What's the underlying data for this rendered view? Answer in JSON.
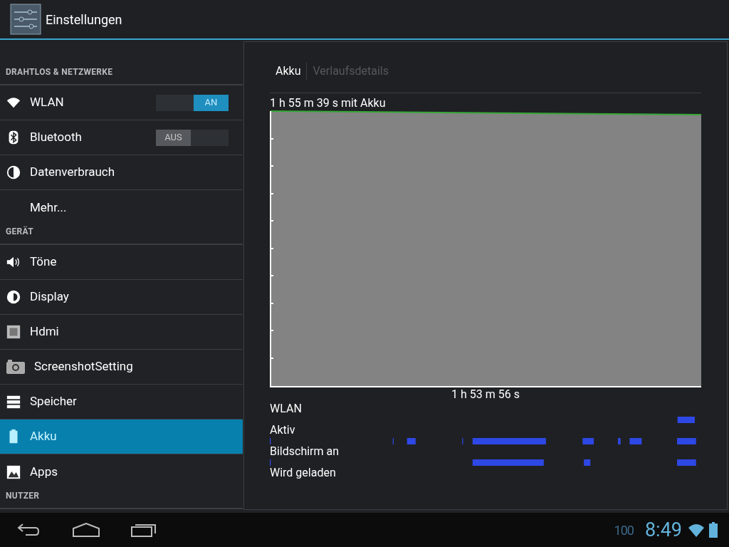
{
  "action_bar": {
    "title": "Einstellungen"
  },
  "sidebar": {
    "sections": [
      {
        "header": "DRAHTLOS & NETZWERKE",
        "items": [
          {
            "label": "WLAN",
            "kind": "toggle",
            "toggle": {
              "label": "AN",
              "on": true
            },
            "selected": false
          },
          {
            "label": "Bluetooth",
            "kind": "toggle",
            "toggle": {
              "label": "AUS",
              "on": false
            },
            "selected": false
          },
          {
            "label": "Datenverbrauch",
            "kind": "plain",
            "selected": false
          },
          {
            "label": "Mehr...",
            "kind": "plain",
            "selected": false
          }
        ]
      },
      {
        "header": "GERÄT",
        "items": [
          {
            "label": "Töne",
            "kind": "plain",
            "selected": false
          },
          {
            "label": "Display",
            "kind": "plain",
            "selected": false
          },
          {
            "label": "Hdmi",
            "kind": "plain",
            "selected": false
          },
          {
            "label": "ScreenshotSetting",
            "kind": "plain",
            "selected": false
          },
          {
            "label": "Speicher",
            "kind": "plain",
            "selected": false
          },
          {
            "label": "Akku",
            "kind": "plain",
            "selected": true
          },
          {
            "label": "Apps",
            "kind": "plain",
            "selected": false
          }
        ]
      },
      {
        "header": "NUTZER"
      }
    ]
  },
  "detail": {
    "breadcrumbs": [
      {
        "label": "Akku",
        "selected": true
      },
      {
        "label": "Verlaufsdetails",
        "selected": false
      }
    ],
    "graph_title": "1 h 55 m 39 s mit Akku",
    "graph_time": "1 h 53 m 56 s",
    "signals": [
      "WLAN",
      "Aktiv",
      "Bildschirm an",
      "Wird geladen"
    ]
  },
  "status_bar": {
    "level_text": "100",
    "time": "8:49"
  }
}
